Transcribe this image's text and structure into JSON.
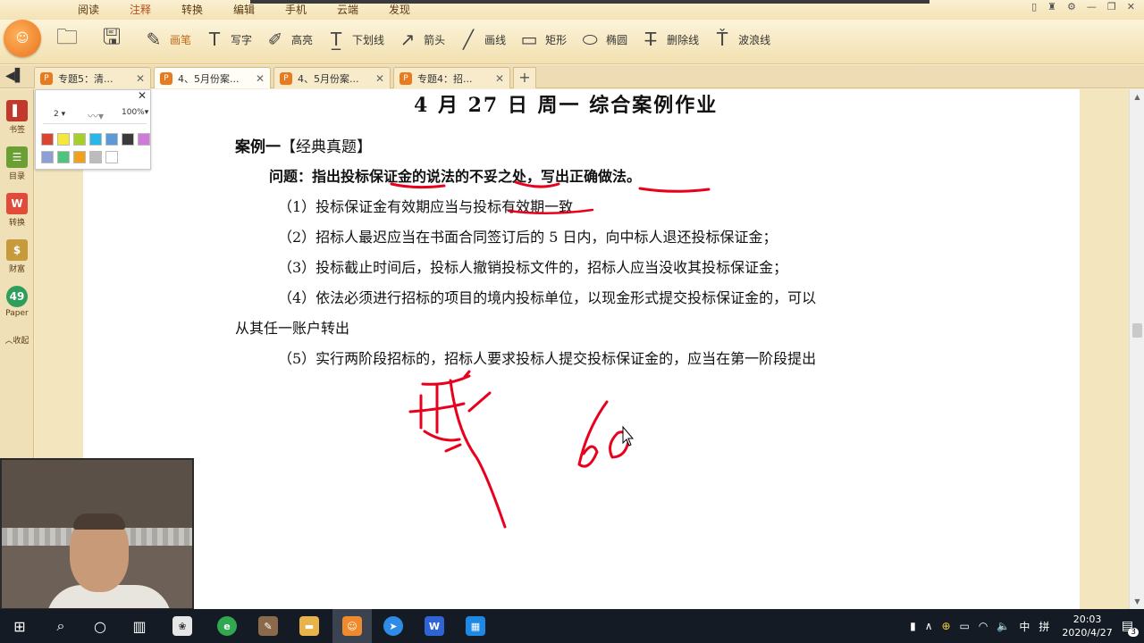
{
  "menu": {
    "items": [
      "阅读",
      "注释",
      "转换",
      "编辑",
      "手机",
      "云端",
      "发现"
    ],
    "active_index": 1
  },
  "toolbar": {
    "tools": [
      {
        "icon": "pen-icon",
        "label": "画笔"
      },
      {
        "icon": "write-text-icon",
        "label": "写字"
      },
      {
        "icon": "highlight-icon",
        "label": "高亮"
      },
      {
        "icon": "underline-icon",
        "label": "下划线"
      },
      {
        "icon": "arrow-icon",
        "label": "箭头"
      },
      {
        "icon": "line-icon",
        "label": "画线"
      },
      {
        "icon": "rectangle-icon",
        "label": "矩形"
      },
      {
        "icon": "ellipse-icon",
        "label": "椭圆"
      },
      {
        "icon": "strikethrough-icon",
        "label": "删除线"
      },
      {
        "icon": "wavy-line-icon",
        "label": "波浪线"
      }
    ]
  },
  "tabs": [
    {
      "label": "专题5：清...",
      "active": false
    },
    {
      "label": "4、5月份案...",
      "active": true
    },
    {
      "label": "4、5月份案...",
      "active": false
    },
    {
      "label": "专题4：招...",
      "active": false
    }
  ],
  "sidebar": {
    "items": [
      {
        "label": "书签",
        "icon": "bookmark-icon",
        "color": "#c0392b"
      },
      {
        "label": "目录",
        "icon": "toc-icon",
        "color": "#6aa033"
      },
      {
        "label": "转换",
        "icon": "convert-icon",
        "color": "#e04b3a"
      },
      {
        "label": "财富",
        "icon": "wealth-icon",
        "color": "#c79a3c"
      },
      {
        "label": "Paper",
        "icon": "paper-icon",
        "color": "#2e9e5b"
      },
      {
        "label": "收起",
        "icon": "collapse-icon",
        "color": "#efe0b8"
      }
    ],
    "badge": "49"
  },
  "palette": {
    "pen_width": "2",
    "zoom": "100%",
    "colors": [
      "#d9452f",
      "#f5e83a",
      "#a6cf2a",
      "#2ab7e8",
      "#5b9ad6",
      "#3a3a3a",
      "#d07ad8",
      "#8e9fd6",
      "#4ec57e",
      "#f0a21e",
      "#bcbcbc",
      "#ffffff"
    ]
  },
  "document": {
    "title": "4 月 27 日  周一  综合案例作业",
    "case_heading": "案例一",
    "case_tag": "【经典真题】",
    "question": "问题：指出投标保证金的说法的不妥之处，写出正确做法。",
    "items": [
      "（1）投标保证金有效期应当与投标有效期一致",
      "（2）招标人最迟应当在书面合同签订后的 5 日内，向中标人退还投标保证金；",
      "（3）投标截止时间后，投标人撤销投标文件的，招标人应当没收其投标保证金；",
      "（4）依法必须进行招标的项目的境内投标单位，以现金形式提交投标保证金的，可以",
      "从其任一账户转出",
      "（5）实行两阶段招标的，招标人要求投标人提交投标保证金的，应当在第一阶段提出"
    ]
  },
  "taskbar": {
    "apps": [
      "start-icon",
      "search-icon",
      "cortana-icon",
      "task-view-icon",
      "app-icon",
      "browser-icon",
      "paint-icon",
      "file-explorer-icon",
      "pdf-reader-icon",
      "feishu-icon",
      "wps-icon",
      "calendar-app-icon"
    ],
    "tray": {
      "ime": "中",
      "layout": "拼"
    },
    "time": "20:03",
    "date": "2020/4/27",
    "notifications": "3"
  }
}
